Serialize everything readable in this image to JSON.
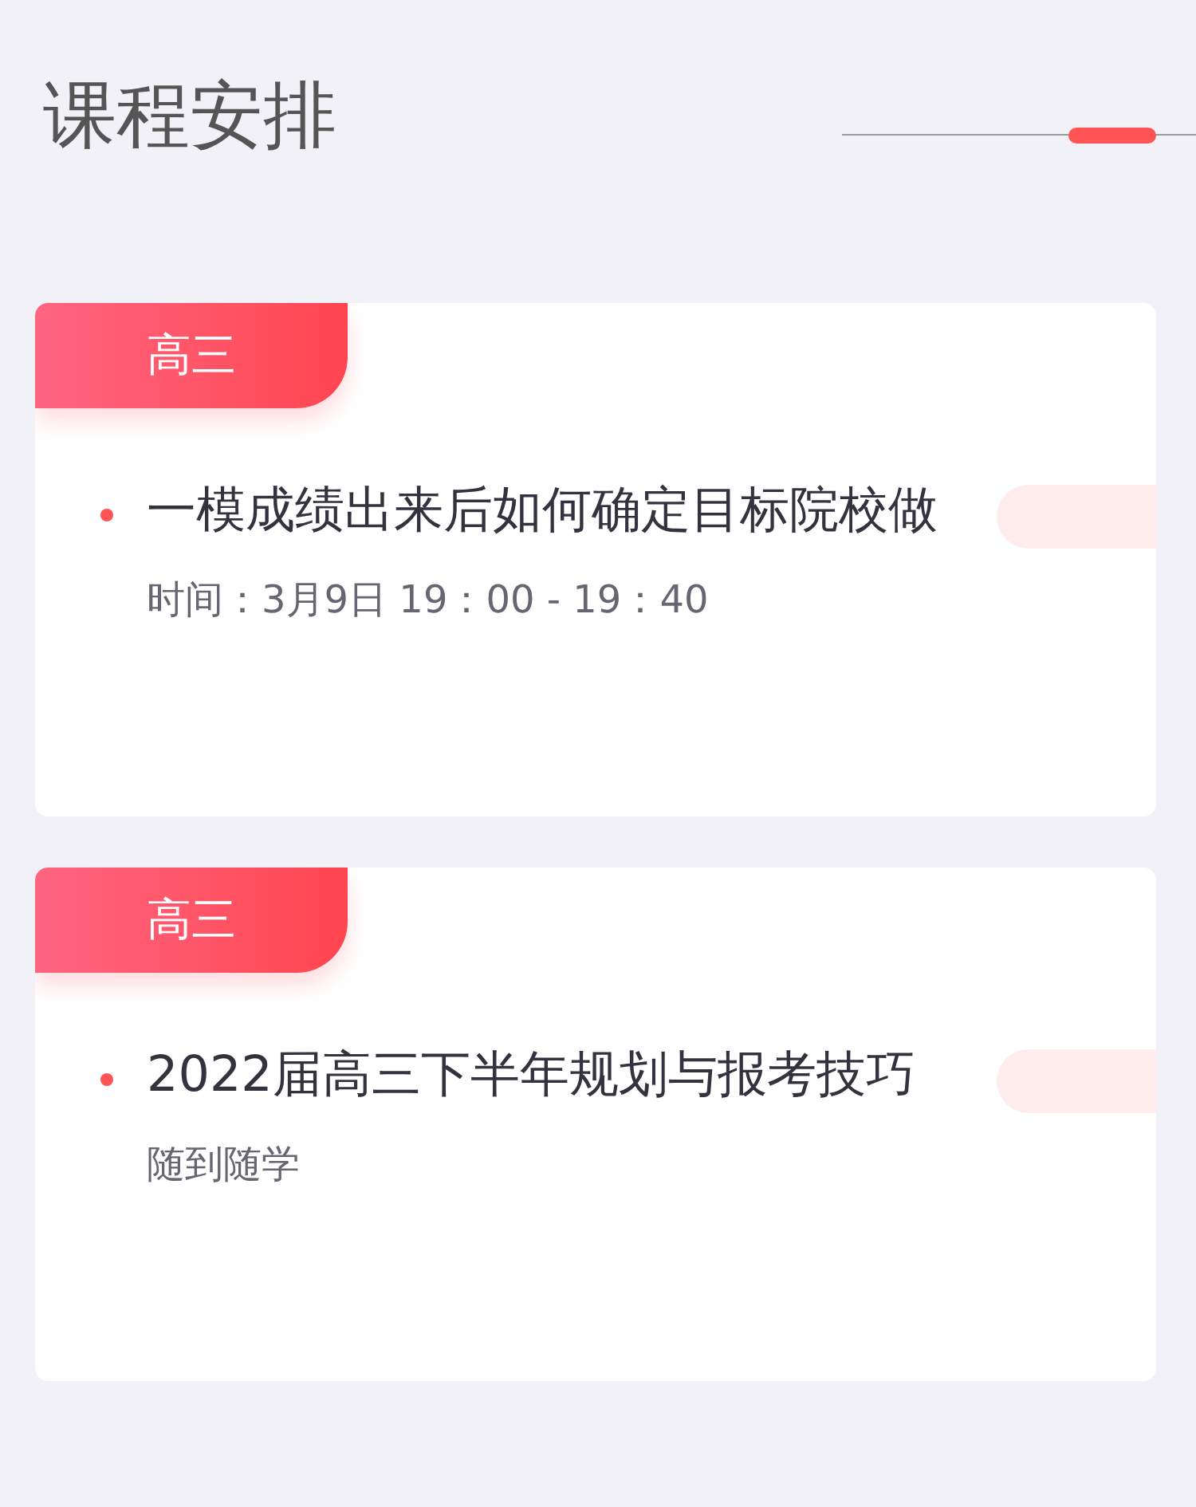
{
  "header": {
    "title": "课程安排"
  },
  "courses": [
    {
      "tag": "高三",
      "title": "一模成绩出来后如何确定目标院校做",
      "subtitle": "时间：3月9日 19：00 - 19：40"
    },
    {
      "tag": "高三",
      "title": "2022届高三下半年规划与报考技巧",
      "subtitle": "随到随学"
    }
  ]
}
